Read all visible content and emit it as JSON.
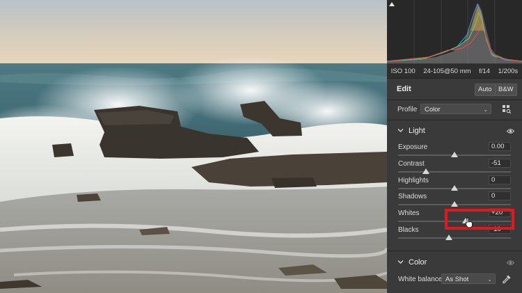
{
  "camera_info": {
    "iso": "ISO 100",
    "lens": "24-105@50 mm",
    "aperture": "f/14",
    "shutter": "1/200s"
  },
  "edit": {
    "title": "Edit",
    "auto_label": "Auto",
    "bw_label": "B&W"
  },
  "profile": {
    "label": "Profile",
    "value": "Color"
  },
  "light": {
    "title": "Light",
    "sliders": [
      {
        "label": "Exposure",
        "value": "0.00",
        "level": 0.5
      },
      {
        "label": "Contrast",
        "value": "-51",
        "level": 0.245
      },
      {
        "label": "Highlights",
        "value": "0",
        "level": 0.5
      },
      {
        "label": "Shadows",
        "value": "0",
        "level": 0.5
      },
      {
        "label": "Whites",
        "value": "+20",
        "level": 0.6
      },
      {
        "label": "Blacks",
        "value": "-10",
        "level": 0.45
      }
    ]
  },
  "color": {
    "title": "Color",
    "white_balance_label": "White balance",
    "white_balance_value": "As Shot"
  },
  "colors": {
    "highlight": "#e0191e",
    "panel_bg": "#3a3a3a"
  }
}
